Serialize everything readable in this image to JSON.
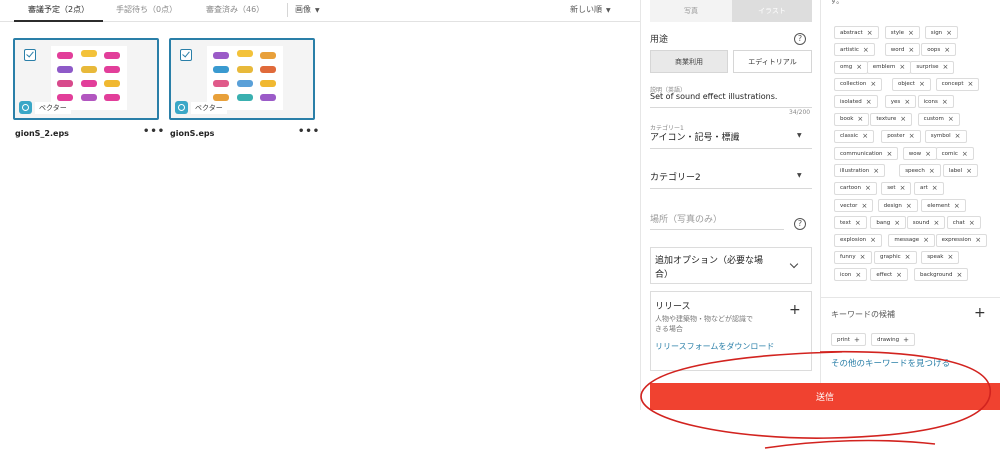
{
  "tabs": [
    {
      "label": "審議予定（2点）"
    },
    {
      "label": "手認待ち（0点）"
    },
    {
      "label": "審査済み（46）"
    }
  ],
  "filter_label": "画像",
  "sort_label": "新しい順",
  "files": [
    {
      "name": "gionS_2.eps",
      "badge": "ベクター",
      "more": "•••"
    },
    {
      "name": "gionS.eps",
      "badge": "ベクター",
      "more": "•••"
    }
  ],
  "type_toggle": {
    "left": "写真",
    "right": "イラスト"
  },
  "usage": {
    "label": "用途",
    "help": "?",
    "commercial": "商業利用",
    "editorial": "エディトリアル"
  },
  "description": {
    "label": "説明（英語）",
    "value": "Set of sound effect illustrations.",
    "counter": "34/200"
  },
  "category1": {
    "label": "カテゴリー1",
    "value": "アイコン・記号・標識"
  },
  "category2": {
    "label": "カテゴリー2"
  },
  "location": {
    "placeholder": "場所（写真のみ）",
    "help": "?"
  },
  "additional_options": {
    "line1": "追加オプション（必要な場",
    "line2": "合）"
  },
  "release": {
    "title": "リリース",
    "desc_line1": "人物や建築物・物などが認識で",
    "desc_line2": "きる場合",
    "link": "リリースフォームをダウンロード"
  },
  "submit_label": "送信",
  "keywords_header": "す。",
  "keywords": [
    "abstract",
    "style",
    "sign",
    "artistic",
    "word",
    "oops",
    "omg",
    "emblem",
    "surprise",
    "collection",
    "object",
    "concept",
    "isolated",
    "yes",
    "icons",
    "book",
    "texture",
    "custom",
    "classic",
    "poster",
    "symbol",
    "communication",
    "wow",
    "comic",
    "illustration",
    "speech",
    "label",
    "cartoon",
    "set",
    "art",
    "vector",
    "design",
    "element",
    "text",
    "bang",
    "sound",
    "chat",
    "explosion",
    "message",
    "expression",
    "funny",
    "graphic",
    "speak",
    "icon",
    "effect",
    "background"
  ],
  "suggestions": {
    "label": "キーワードの候補",
    "items": [
      "print",
      "drawing"
    ],
    "more_link": "その他のキーワードを見つける"
  },
  "colors": {
    "accent": "#2a7fa8",
    "submit": "#f04230",
    "annotation": "#d2231f"
  }
}
